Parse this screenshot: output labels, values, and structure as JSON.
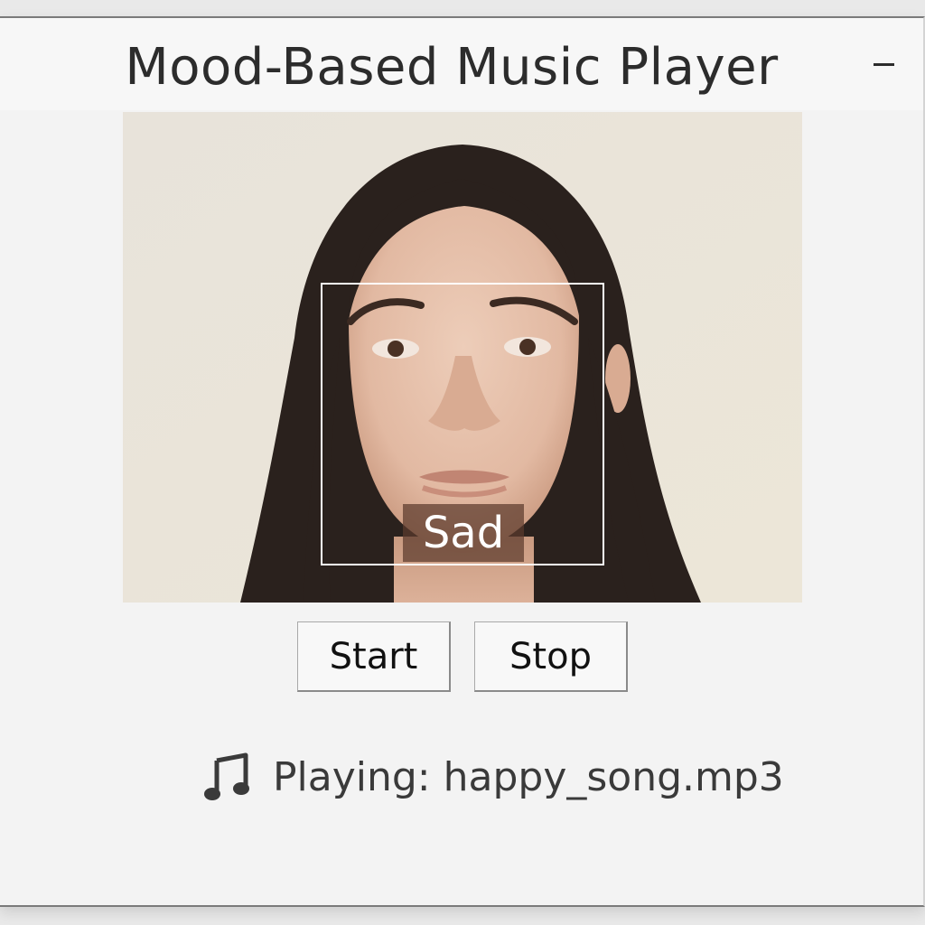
{
  "window": {
    "title": "Mood-Based Music Player",
    "minimize_icon": "minimize-icon"
  },
  "camera": {
    "detected_emotion": "Sad"
  },
  "controls": {
    "start_label": "Start",
    "stop_label": "Stop"
  },
  "status": {
    "icon": "music-note-icon",
    "text": "Playing: happy_song.mp3"
  },
  "colors": {
    "window_bg": "#f3f3f3",
    "title_text": "#2c2c2c",
    "face_box": "#ffffff",
    "emotion_label_bg": "#5c3a2c"
  }
}
